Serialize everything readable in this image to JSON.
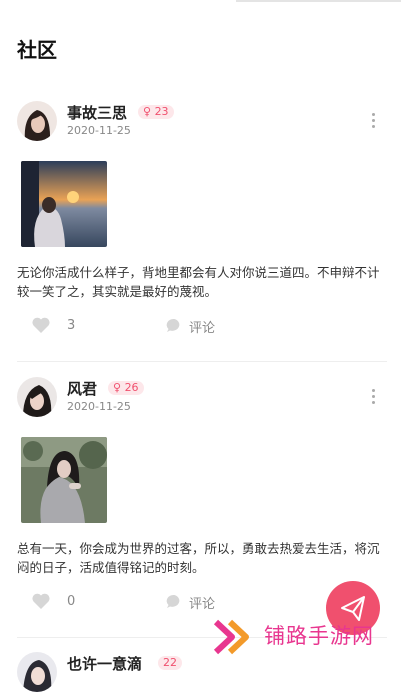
{
  "header": {
    "title": "社区"
  },
  "posts": [
    {
      "username": "事故三思",
      "gender_symbol": "♀",
      "age": "23",
      "date": "2020-11-25",
      "content": "无论你活成什么样子，背地里都会有人对你说三道四。不申辩不计较一笑了之，其实就是最好的蔑视。",
      "likes": "3",
      "comment_label": "评论"
    },
    {
      "username": "风君",
      "gender_symbol": "♀",
      "age": "26",
      "date": "2020-11-25",
      "content": "总有一天，你会成为世界的过客，所以，勇敢去热爱去生活，将沉闷的日子，活成值得铭记的时刻。",
      "likes": "0",
      "comment_label": "评论"
    },
    {
      "username": "也许一意滴",
      "age": "22"
    }
  ],
  "watermark": {
    "text": "铺路手游网"
  },
  "colors": {
    "accent": "#f0506e",
    "badge_bg": "#fde7ea",
    "watermark": "#e8368f"
  }
}
